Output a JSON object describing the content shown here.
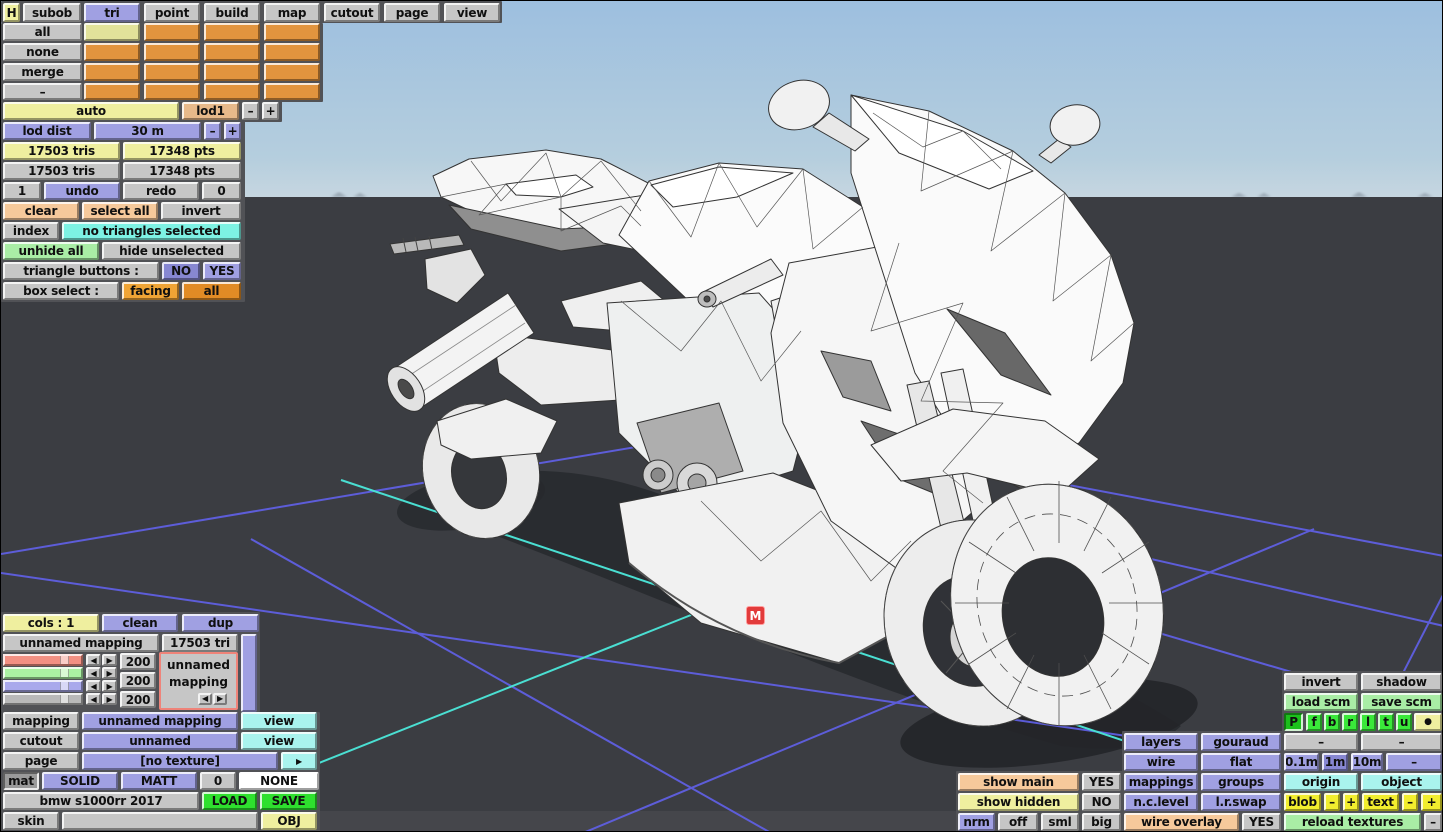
{
  "viewport": {
    "marker": "M"
  },
  "colors": {
    "sky_top": "#9dbfdf",
    "sky_horizon": "#c6d6e0",
    "ground": "#3b3d42",
    "grid_blue": "#6060e6",
    "grid_cyan": "#4adfd2",
    "marker_red": "#e23b3b",
    "accent_purple": "#a0a0e2",
    "accent_cyan": "#7df2e4",
    "accent_orange": "#f0a435",
    "accent_green": "#2ee02e",
    "panel_backdrop": "#515256"
  },
  "menu": {
    "home": "H",
    "tabs": [
      "subob",
      "tri",
      "point",
      "build",
      "map",
      "cutout",
      "page",
      "view"
    ],
    "active_tab": "tri"
  },
  "subob": {
    "row_labels": [
      "all",
      "none",
      "merge",
      "–"
    ]
  },
  "lod": {
    "auto": "auto",
    "level": "lod1",
    "minus": "–",
    "plus": "+",
    "dist_label": "lod dist",
    "dist_value": "30 m"
  },
  "stats": {
    "tris_active": "17503 tris",
    "pts_active": "17348 pts",
    "tris_total": "17503 tris",
    "pts_total": "17348 pts"
  },
  "history": {
    "undo_count": "1",
    "undo": "undo",
    "redo": "redo",
    "redo_count": "0"
  },
  "selection": {
    "clear": "clear",
    "select_all": "select all",
    "invert": "invert",
    "index": "index",
    "status": "no triangles selected",
    "unhide_all": "unhide all",
    "hide_unselected": "hide unselected",
    "triangle_buttons_label": "triangle buttons :",
    "no": "NO",
    "yes": "YES",
    "box_select_label": "box select :",
    "facing": "facing",
    "all": "all"
  },
  "mapping_panel": {
    "cols": "cols : 1",
    "clean": "clean",
    "dup": "dup",
    "name": "unnamed mapping",
    "tri_count": "17503 tri",
    "channel_values": [
      "200",
      "200",
      "200"
    ],
    "box_line1": "unnamed",
    "box_line2": "mapping",
    "rows": [
      {
        "label": "mapping",
        "value": "unnamed mapping",
        "action": "view"
      },
      {
        "label": "cutout",
        "value": "unnamed",
        "action": "view"
      },
      {
        "label": "page",
        "value": "[no texture]",
        "action": "▶"
      }
    ],
    "mat_label": "mat",
    "mat_type": "SOLID",
    "mat_finish": "MATT",
    "mat_num": "0",
    "mat_tex": "NONE",
    "file_name": "bmw s1000rr 2017",
    "load": "LOAD",
    "save": "SAVE",
    "skin": "skin",
    "obj": "OBJ"
  },
  "right_panel": {
    "invert": "invert",
    "shadow": "shadow",
    "load_scm": "load scm",
    "save_scm": "save scm",
    "view_letters": [
      "P",
      "f",
      "b",
      "r",
      "l",
      "t",
      "u",
      "●"
    ],
    "layers": "layers",
    "gouraud": "gouraud",
    "dash1": "–",
    "dash2": "–",
    "wire": "wire",
    "flat": "flat",
    "m01": "0.1m",
    "m1": "1m",
    "m10": "10m",
    "wdash": "–",
    "mappings": "mappings",
    "groups": "groups",
    "origin": "origin",
    "object": "object",
    "nclevel": "n.c.level",
    "lrswap": "l.r.swap",
    "blob": "blob",
    "blob_minus": "–",
    "blob_plus": "+",
    "text": "text",
    "text_minus": "–",
    "text_plus": "+",
    "wire_overlay": "wire overlay",
    "wire_overlay_value": "YES",
    "reload_textures": "reload textures",
    "rt_dash": "–"
  },
  "display_panel": {
    "show_main": "show main",
    "show_main_value": "YES",
    "show_hidden": "show hidden",
    "show_hidden_value": "NO",
    "nrm": "nrm",
    "off": "off",
    "sml": "sml",
    "big": "big"
  },
  "icons": {
    "arrow_left": "◀",
    "arrow_right": "▶"
  }
}
